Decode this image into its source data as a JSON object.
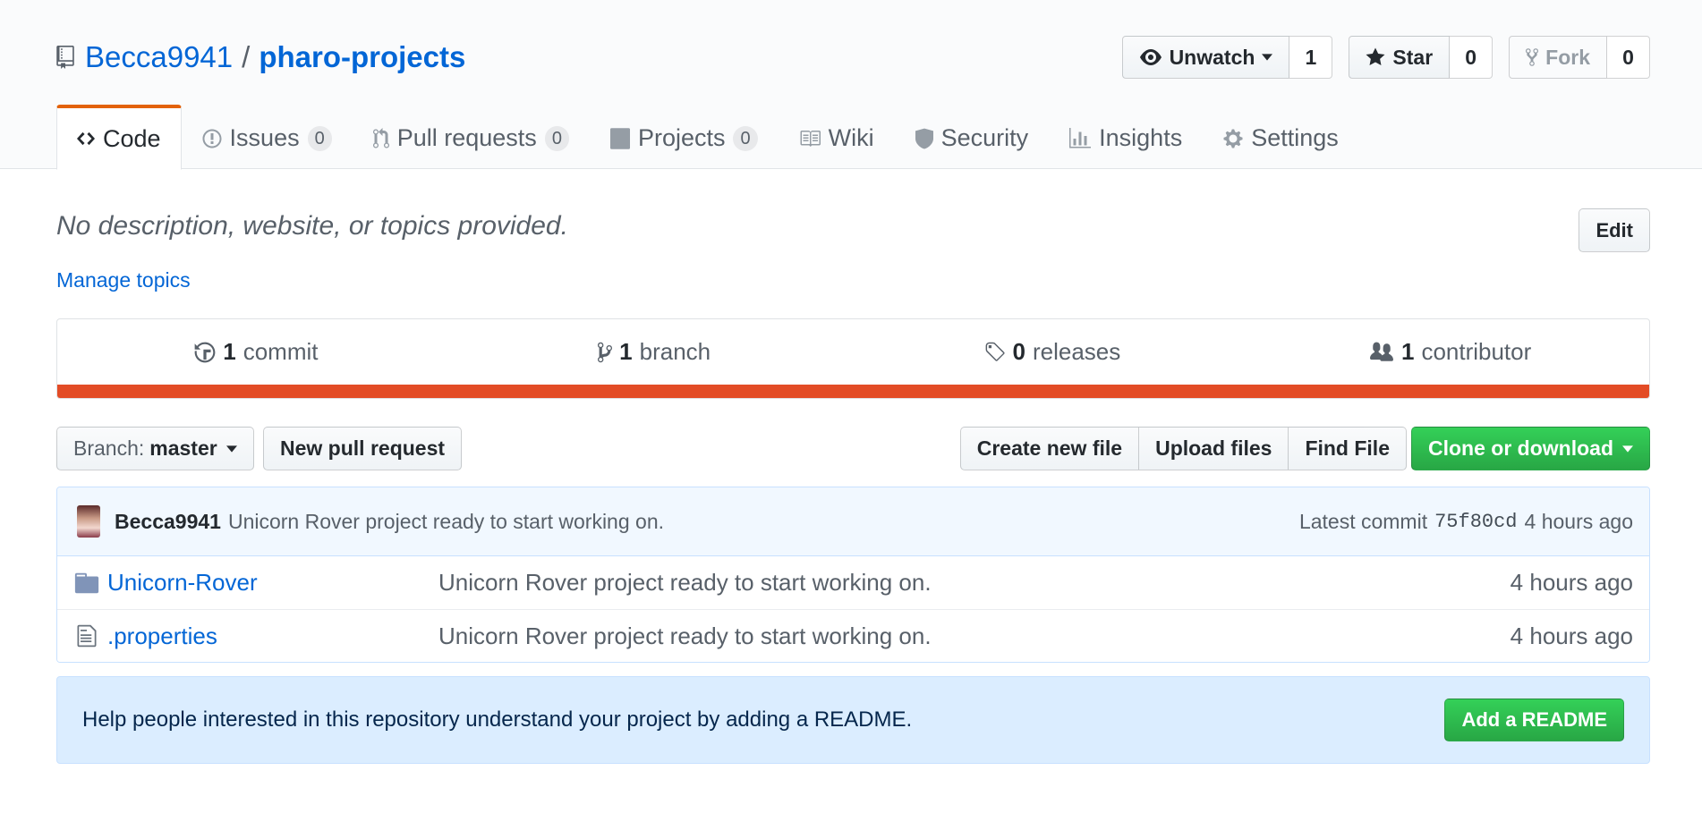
{
  "repo": {
    "owner": "Becca9941",
    "separator": "/",
    "name": "pharo-projects"
  },
  "actions": {
    "watch_label": "Unwatch",
    "watch_count": "1",
    "star_label": "Star",
    "star_count": "0",
    "fork_label": "Fork",
    "fork_count": "0"
  },
  "tabs": [
    {
      "label": "Code",
      "icon": "code-icon",
      "selected": true
    },
    {
      "label": "Issues",
      "count": "0",
      "icon": "issue-icon"
    },
    {
      "label": "Pull requests",
      "count": "0",
      "icon": "pull-request-icon"
    },
    {
      "label": "Projects",
      "count": "0",
      "icon": "project-icon"
    },
    {
      "label": "Wiki",
      "icon": "book-icon"
    },
    {
      "label": "Security",
      "icon": "shield-icon"
    },
    {
      "label": "Insights",
      "icon": "graph-icon"
    },
    {
      "label": "Settings",
      "icon": "gear-icon"
    }
  ],
  "description": {
    "text": "No description, website, or topics provided.",
    "manage_topics": "Manage topics",
    "edit_label": "Edit"
  },
  "summary": {
    "commits_num": "1",
    "commits_label": "commit",
    "branches_num": "1",
    "branches_label": "branch",
    "releases_num": "0",
    "releases_label": "releases",
    "contributors_num": "1",
    "contributors_label": "contributor",
    "language_color": "#e34c26"
  },
  "file_nav": {
    "branch_prefix": "Branch:",
    "branch_name": "master",
    "new_pr": "New pull request",
    "create_file": "Create new file",
    "upload_files": "Upload files",
    "find_file": "Find File",
    "clone": "Clone or download"
  },
  "commit": {
    "author": "Becca9941",
    "message": "Unicorn Rover project ready to start working on.",
    "latest_label": "Latest commit",
    "sha": "75f80cd",
    "age": "4 hours ago"
  },
  "files": [
    {
      "name": "Unicorn-Rover",
      "type": "folder",
      "message": "Unicorn Rover project ready to start working on.",
      "age": "4 hours ago"
    },
    {
      "name": ".properties",
      "type": "file",
      "message": "Unicorn Rover project ready to start working on.",
      "age": "4 hours ago"
    }
  ],
  "readme": {
    "text": "Help people interested in this repository understand your project by adding a README.",
    "button": "Add a README"
  }
}
